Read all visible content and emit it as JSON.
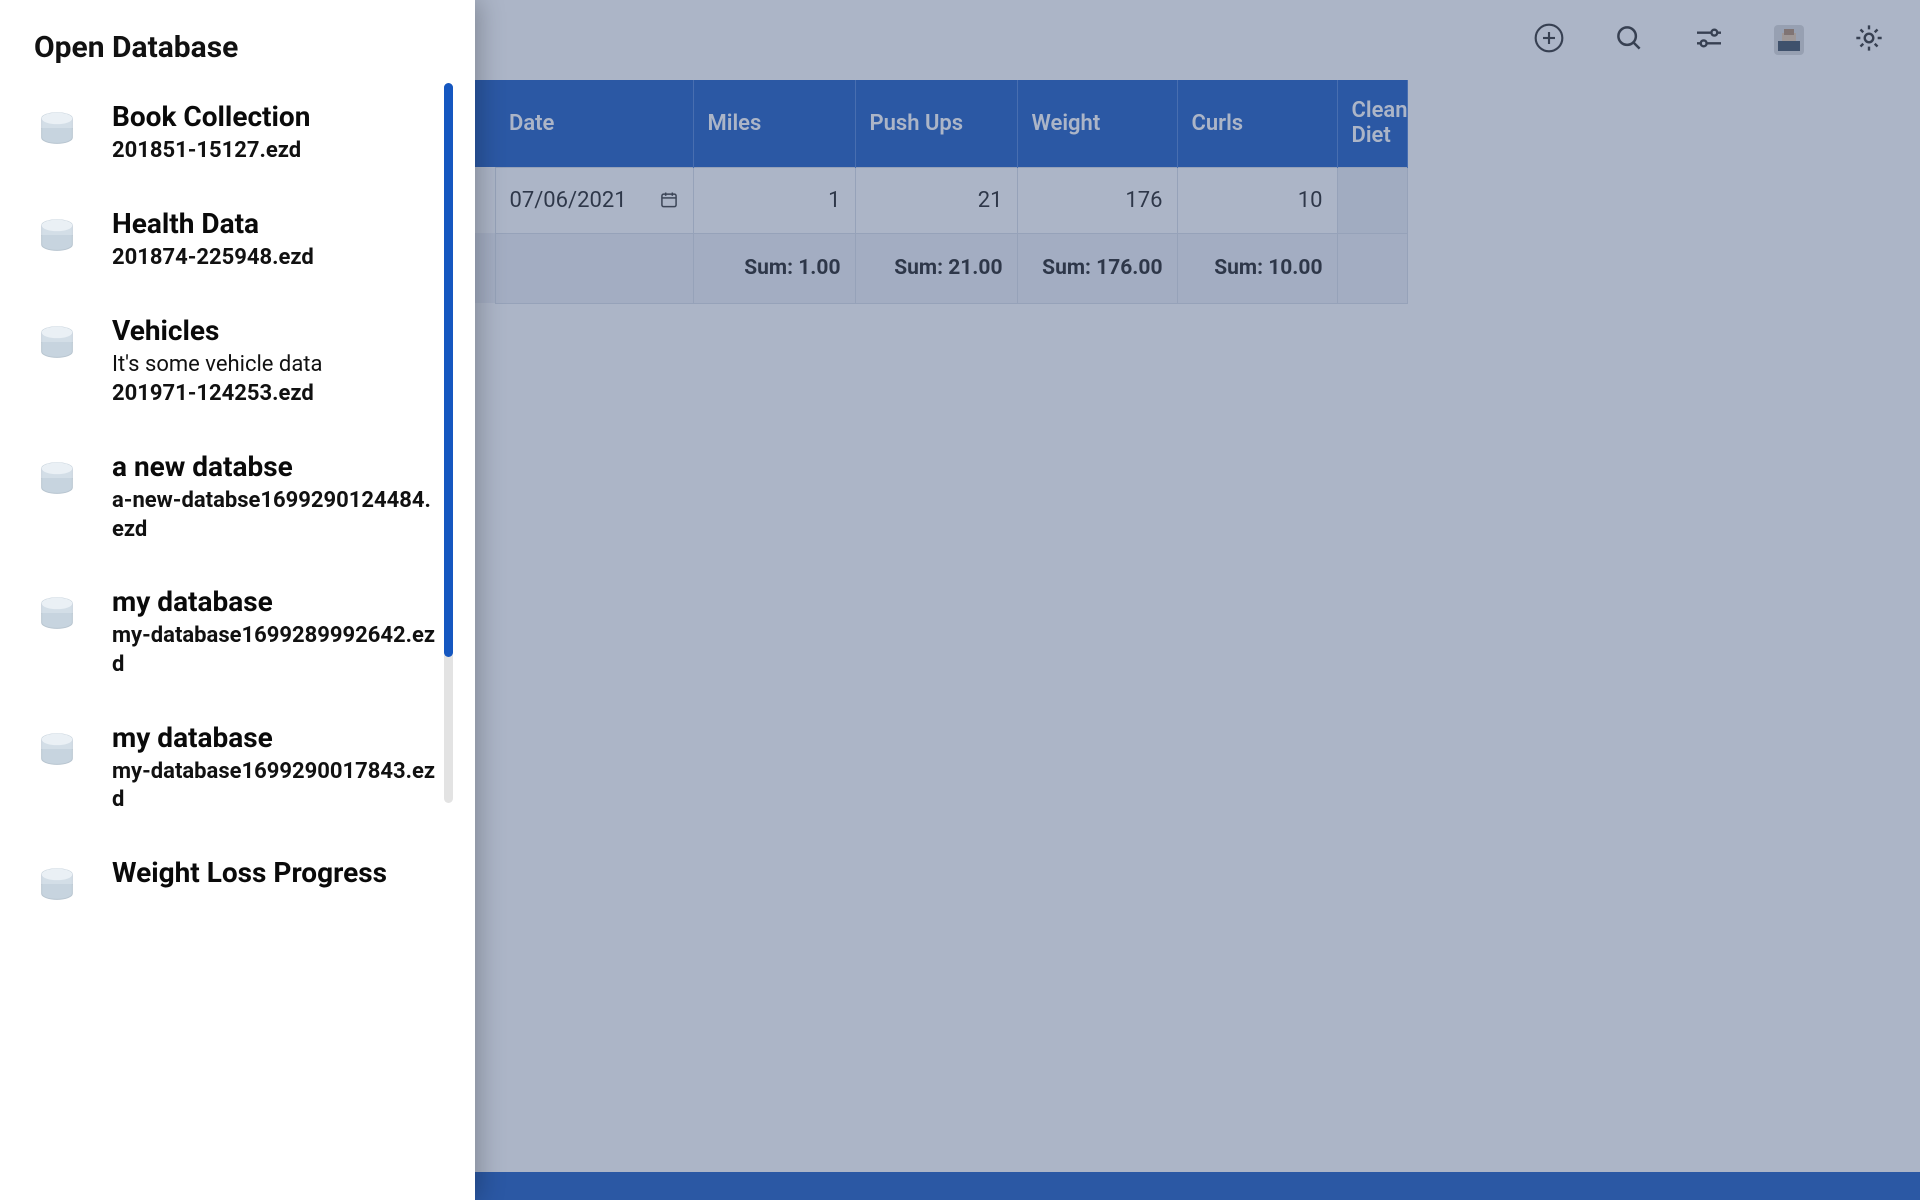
{
  "drawer": {
    "title": "Open Database",
    "scroll": {
      "track_h": 720,
      "thumb_h": 574,
      "thumb_top": 0
    },
    "items": [
      {
        "name": "Book Collection",
        "desc": "",
        "file": "201851-15127.ezd"
      },
      {
        "name": "Health Data",
        "desc": "",
        "file": "201874-225948.ezd"
      },
      {
        "name": "Vehicles",
        "desc": "It's some vehicle data",
        "file": "201971-124253.ezd"
      },
      {
        "name": "a new databse",
        "desc": "",
        "file": "a-new-databse1699290124484.ezd"
      },
      {
        "name": "my database",
        "desc": "",
        "file": "my-database1699289992642.ezd"
      },
      {
        "name": "my database",
        "desc": "",
        "file": "my-database1699290017843.ezd"
      },
      {
        "name": "Weight Loss Progress",
        "desc": "",
        "file": ""
      }
    ]
  },
  "toolbar": {
    "add_icon": "plus-circle",
    "search_icon": "search",
    "filter_icon": "sliders",
    "avatar_icon": "avatar",
    "settings_icon": "gear"
  },
  "table": {
    "columns": [
      "Date",
      "Miles",
      "Push Ups",
      "Weight",
      "Curls",
      "Clean Diet"
    ],
    "rows": [
      {
        "date": "07/06/2021",
        "miles": "1",
        "pushups": "21",
        "weight": "176",
        "curls": "10",
        "clean": ""
      }
    ],
    "sums": {
      "miles": "Sum: 1.00",
      "pushups": "Sum: 21.00",
      "weight": "Sum: 176.00",
      "curls": "Sum: 10.00"
    }
  },
  "colors": {
    "header_blue": "#1557c0",
    "overlay": "rgba(70,90,130,0.45)"
  }
}
